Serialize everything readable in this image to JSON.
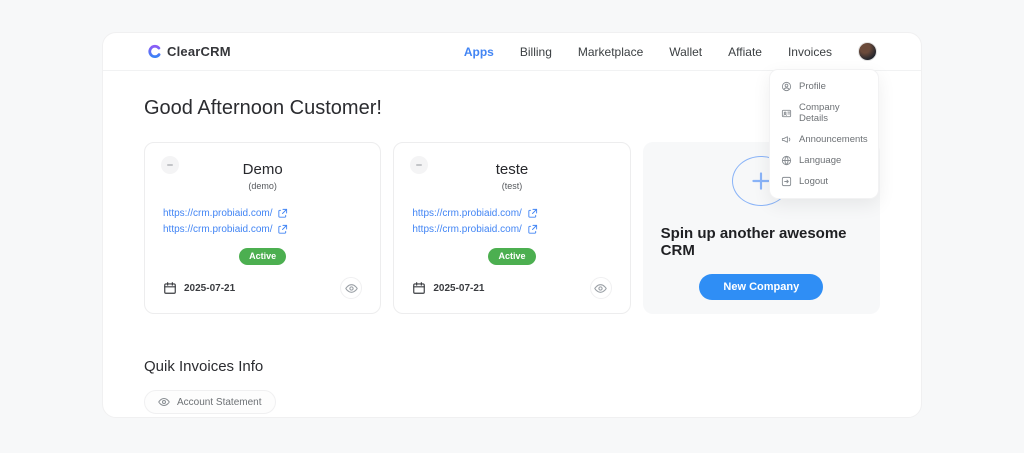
{
  "brand": {
    "name": "ClearCRM"
  },
  "nav": {
    "items": [
      {
        "label": "Apps",
        "active": true
      },
      {
        "label": "Billing",
        "active": false
      },
      {
        "label": "Marketplace",
        "active": false
      },
      {
        "label": "Wallet",
        "active": false
      },
      {
        "label": "Affiate",
        "active": false
      },
      {
        "label": "Invoices",
        "active": false
      }
    ]
  },
  "user_menu": {
    "items": [
      {
        "label": "Profile",
        "icon": "profile-icon"
      },
      {
        "label": "Company Details",
        "icon": "company-details-icon"
      },
      {
        "label": "Announcements",
        "icon": "announcements-icon"
      },
      {
        "label": "Language",
        "icon": "language-icon"
      },
      {
        "label": "Logout",
        "icon": "logout-icon"
      }
    ]
  },
  "greeting": "Good Afternoon Customer!",
  "apps": [
    {
      "name": "Demo",
      "slug": "(demo)",
      "links": [
        "https://crm.probiaid.com/",
        "https://crm.probiaid.com/"
      ],
      "status": "Active",
      "date": "2025-07-21"
    },
    {
      "name": "teste",
      "slug": "(test)",
      "links": [
        "https://crm.probiaid.com/",
        "https://crm.probiaid.com/"
      ],
      "status": "Active",
      "date": "2025-07-21"
    }
  ],
  "new_app_card": {
    "title": "Spin up another awesome CRM",
    "button_label": "New Company"
  },
  "invoices_section": {
    "title": "Quik Invoices Info",
    "button_label": "Account Statement"
  },
  "colors": {
    "accent_blue": "#2f8ef5",
    "link_blue": "#4285f4",
    "active_green": "#4caf50",
    "logo_purple": "#8b5cf6",
    "logo_blue": "#3b82f6",
    "page_bg": "#f7f8f9"
  }
}
